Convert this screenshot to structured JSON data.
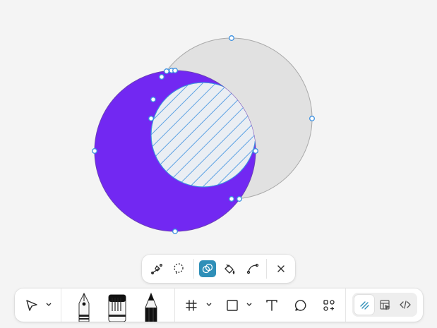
{
  "canvas": {
    "colors": {
      "subject_fill": "#7228f2",
      "subject_stroke": "#6a3fb8",
      "other_fill": "#e1e1e1",
      "other_stroke": "#a9a9a9",
      "selection": "#3a8fe0",
      "hatch": "#3a8fe0"
    },
    "shapes": [
      "circle-purple",
      "circle-gray",
      "intersection-selection"
    ]
  },
  "context_bar": {
    "items": [
      {
        "name": "path-edit-tool",
        "icon": "pen-path-icon"
      },
      {
        "name": "lasso-select-tool",
        "icon": "lasso-icon"
      },
      {
        "name": "boolean-ops-tool",
        "icon": "boolean-icon",
        "active": true
      },
      {
        "name": "fill-tool",
        "icon": "paint-bucket-icon"
      },
      {
        "name": "curve-tool",
        "icon": "bend-curve-icon"
      },
      {
        "name": "close-button",
        "icon": "close-icon"
      }
    ],
    "active_color": "#2f8fb8"
  },
  "toolbar": {
    "groups": [
      {
        "name": "select",
        "icon": "pointer-icon",
        "has_caret": true
      },
      {
        "name": "drawing-pens",
        "items": [
          "fountain-pen",
          "marker-brush",
          "pencil"
        ]
      },
      {
        "name": "frame",
        "icon": "frame-hash-icon",
        "has_caret": true
      },
      {
        "name": "shape",
        "icon": "rectangle-icon",
        "has_caret": true
      },
      {
        "name": "text",
        "icon": "text-icon"
      },
      {
        "name": "comment",
        "icon": "comment-bubble-icon"
      },
      {
        "name": "plugins",
        "icon": "shapes-grid-icon"
      }
    ],
    "modes": [
      {
        "name": "draw-mode",
        "icon": "draw-mode-icon",
        "active": true
      },
      {
        "name": "design-mode",
        "icon": "design-mode-icon"
      },
      {
        "name": "dev-mode",
        "icon": "code-icon"
      }
    ]
  }
}
